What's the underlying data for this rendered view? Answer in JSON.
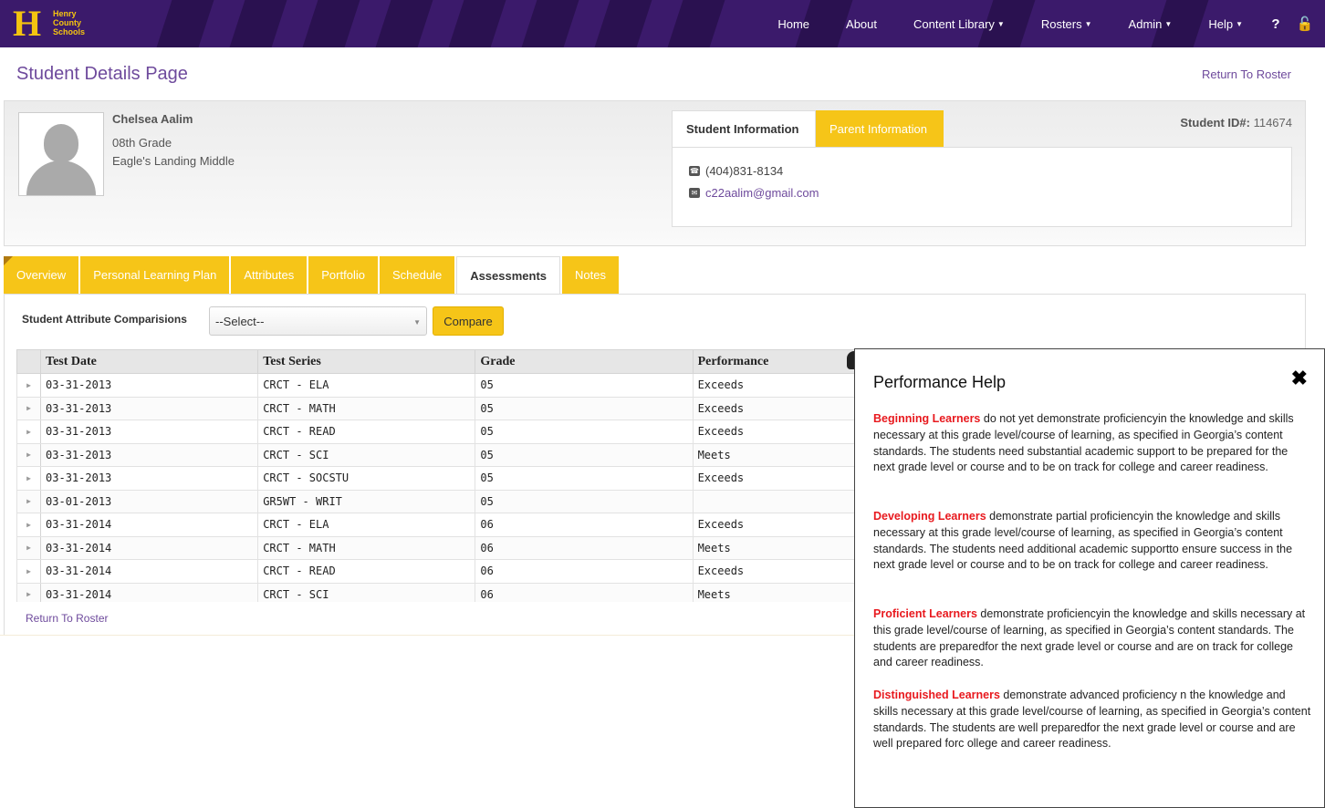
{
  "brand": {
    "line1": "Henry",
    "line2": "County",
    "line3": "Schools",
    "logo_letter": "H"
  },
  "nav": {
    "items": [
      {
        "label": "Home",
        "dropdown": false
      },
      {
        "label": "About",
        "dropdown": false
      },
      {
        "label": "Content Library",
        "dropdown": true
      },
      {
        "label": "Rosters",
        "dropdown": true
      },
      {
        "label": "Admin",
        "dropdown": true
      },
      {
        "label": "Help",
        "dropdown": true
      }
    ],
    "help_icon": "?",
    "lock_icon": "🔓"
  },
  "page": {
    "title": "Student Details Page",
    "return_link": "Return To Roster"
  },
  "student": {
    "name": "Chelsea Aalim",
    "grade": "08th Grade",
    "school": "Eagle's Landing Middle",
    "id_label": "Student ID#:",
    "id_value": "114674",
    "phone": "(404)831-8134",
    "email": "c22aalim@gmail.com"
  },
  "info_tabs": {
    "student": "Student Information",
    "parent": "Parent Information"
  },
  "main_tabs": [
    "Overview",
    "Personal Learning Plan",
    "Attributes",
    "Portfolio",
    "Schedule",
    "Assessments",
    "Notes"
  ],
  "active_tab": "Assessments",
  "compare": {
    "label": "Student Attribute Comparisions",
    "select_value": "--Select--",
    "button": "Compare"
  },
  "table": {
    "headers": [
      "Test Date",
      "Test Series",
      "Grade",
      "Performance",
      ""
    ],
    "rows": [
      [
        "03-31-2013",
        "CRCT - ELA",
        "05",
        "Exceeds"
      ],
      [
        "03-31-2013",
        "CRCT - MATH",
        "05",
        "Exceeds"
      ],
      [
        "03-31-2013",
        "CRCT - READ",
        "05",
        "Exceeds"
      ],
      [
        "03-31-2013",
        "CRCT - SCI",
        "05",
        "Meets"
      ],
      [
        "03-31-2013",
        "CRCT - SOCSTU",
        "05",
        "Exceeds"
      ],
      [
        "03-01-2013",
        "GR5WT - WRIT",
        "05",
        ""
      ],
      [
        "03-31-2014",
        "CRCT - ELA",
        "06",
        "Exceeds"
      ],
      [
        "03-31-2014",
        "CRCT - MATH",
        "06",
        "Meets"
      ],
      [
        "03-31-2014",
        "CRCT - READ",
        "06",
        "Exceeds"
      ],
      [
        "03-31-2014",
        "CRCT - SCI",
        "06",
        "Meets"
      ]
    ]
  },
  "bottom_return": "Return To Roster",
  "help": {
    "title": "Performance Help",
    "close": "✖",
    "paras": [
      {
        "term": "Beginning Learners",
        "text": " do not yet demonstrate proficiencyin the knowledge and skills necessary at this grade level/course of learning, as specified in Georgia’s content standards. The students need substantial academic support to be prepared for the next grade level or course and to be on track for college and career readiness."
      },
      {
        "term": "Developing Learners",
        "text": " demonstrate partial proficiencyin the knowledge and skills necessary at this grade level/course of learning, as specified in Georgia’s content standards. The students need additional academic supportto ensure success in the next grade level or course and to be on track for college and career readiness."
      },
      {
        "term": "Proficient Learners",
        "text": " demonstrate proficiencyin the knowledge and skills necessary at this grade level/course of learning, as specified in Georgia’s content standards. The students are preparedfor the next grade level or course and are on track for college and career readiness."
      },
      {
        "term": "Distinguished Learners",
        "text": " demonstrate advanced proficiency n the knowledge and skills necessary at this grade level/course of learning, as specified in Georgia’s content standards. The students are well preparedfor the next grade level or course and are well prepared forc ollege and career readiness."
      }
    ]
  },
  "colors": {
    "navbar": "#3b1a6b",
    "accent": "#f6c518",
    "link": "#6e4a9c",
    "term": "#e8191e"
  }
}
